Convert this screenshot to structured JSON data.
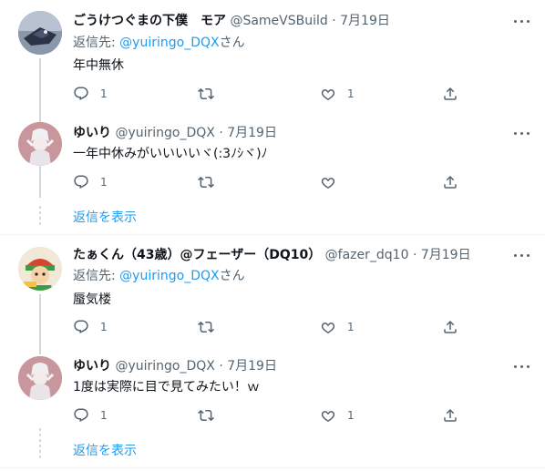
{
  "thread1": {
    "tweet": {
      "name": "ごうけつぐまの下僕　モア",
      "handle": "@SameVSBuild",
      "date": "7月19日",
      "reply_prefix": "返信先: ",
      "reply_mention": "@yuiringo_DQX",
      "reply_suffix": "さん",
      "text": "年中無休",
      "reply_count": "1",
      "like_count": "1"
    },
    "reply": {
      "name": "ゆいり",
      "handle": "@yuiringo_DQX",
      "date": "7月19日",
      "text": "一年中休みがいいいいヾ(:3ﾉｼヾ)ﾉ",
      "reply_count": "1"
    },
    "show_replies": "返信を表示"
  },
  "thread2": {
    "tweet": {
      "name": "たぁくん（43歳）@フェーザー（DQ10）",
      "handle": "@fazer_dq10",
      "date": "7月19日",
      "reply_prefix": "返信先: ",
      "reply_mention": "@yuiringo_DQX",
      "reply_suffix": "さん",
      "text": "蜃気楼",
      "reply_count": "1",
      "like_count": "1"
    },
    "reply": {
      "name": "ゆいり",
      "handle": "@yuiringo_DQX",
      "date": "7月19日",
      "text": "1度は実際に目で見てみたい！ｗ",
      "reply_count": "1",
      "like_count": "1"
    },
    "show_replies": "返信を表示"
  },
  "separator": " · ",
  "colors": {
    "link": "#1d9bf0",
    "muted": "#536471",
    "line": "#cfd9de"
  }
}
